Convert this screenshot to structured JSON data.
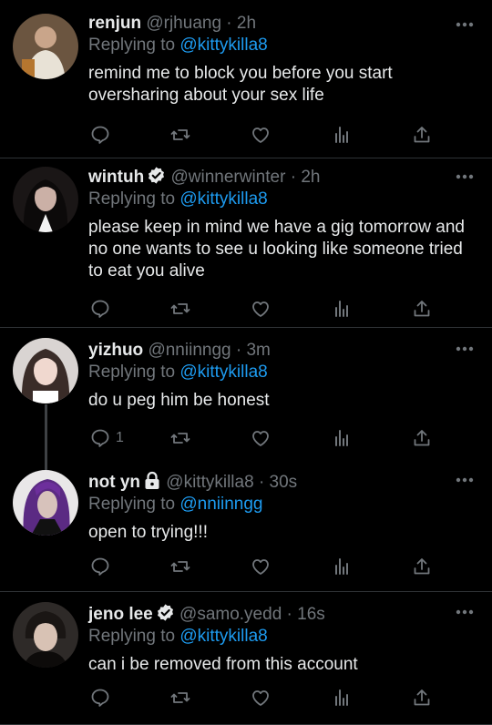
{
  "tweets": [
    {
      "name": "renjun",
      "handle": "@rjhuang",
      "time": "2h",
      "reply_prefix": "Replying to",
      "reply_to": "@kittykilla8",
      "text": "remind me to block you before you start oversharing about your sex life",
      "reply_count": "",
      "verified": false,
      "locked": false
    },
    {
      "name": "wintuh",
      "handle": "@winnerwinter",
      "time": "2h",
      "reply_prefix": "Replying to",
      "reply_to": "@kittykilla8",
      "text": "please keep in mind we have a gig tomorrow and no one wants to see u looking like someone tried to eat you alive",
      "reply_count": "",
      "verified": true,
      "locked": false
    },
    {
      "name": "yizhuo",
      "handle": "@nniinngg",
      "time": "3m",
      "reply_prefix": "Replying to",
      "reply_to": "@kittykilla8",
      "text": "do u peg him be honest",
      "reply_count": "1",
      "verified": false,
      "locked": false
    },
    {
      "name": "not yn",
      "handle": "@kittykilla8",
      "time": "30s",
      "reply_prefix": "Replying to",
      "reply_to": "@nniinngg",
      "text": "open to trying!!!",
      "reply_count": "",
      "verified": false,
      "locked": true
    },
    {
      "name": "jeno lee",
      "handle": "@samo.yedd",
      "time": "16s",
      "reply_prefix": "Replying to",
      "reply_to": "@kittykilla8",
      "text": "can i be removed from this account",
      "reply_count": "",
      "verified": true,
      "locked": false
    }
  ],
  "separator": "·",
  "colors": {
    "background": "#000000",
    "text": "#e7e9ea",
    "muted": "#71767b",
    "link": "#1d9bf0",
    "divider": "#2f3336"
  },
  "icons": [
    "reply-icon",
    "retweet-icon",
    "like-icon",
    "analytics-icon",
    "share-icon",
    "more-icon",
    "verified-badge-icon",
    "lock-icon"
  ]
}
